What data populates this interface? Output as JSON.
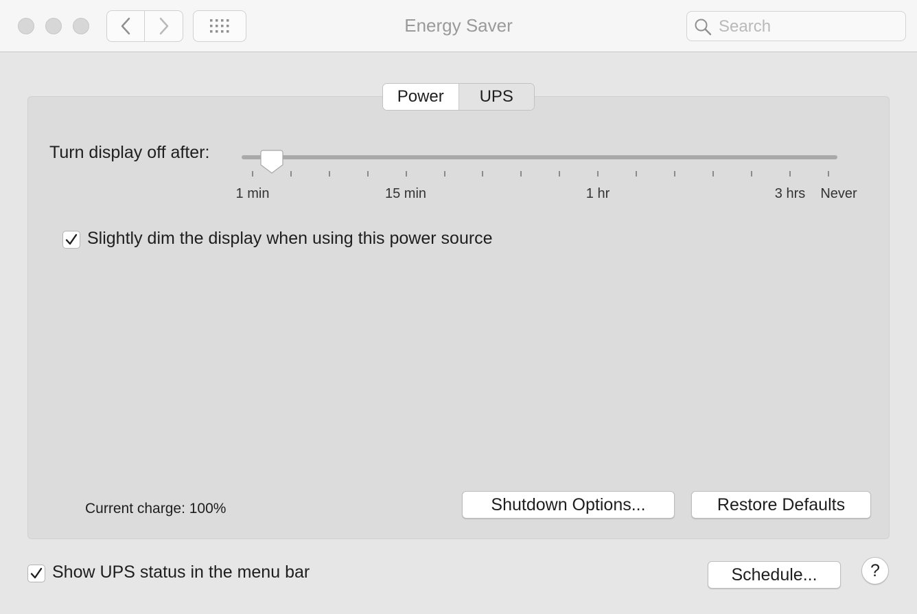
{
  "window": {
    "title": "Energy Saver"
  },
  "toolbar": {
    "search_placeholder": "Search"
  },
  "tabs": [
    {
      "label": "Power",
      "active": false
    },
    {
      "label": "UPS",
      "active": true
    }
  ],
  "display_sleep": {
    "label": "Turn display off after:",
    "value_label": "1 min",
    "tick_labels": [
      "1 min",
      "15 min",
      "1 hr",
      "3 hrs",
      "Never"
    ],
    "tick_count": 16
  },
  "dim_display": {
    "label": "Slightly dim the display when using this power source",
    "checked": true
  },
  "current_charge": "Current charge: 100%",
  "buttons": {
    "shutdown_options": "Shutdown Options...",
    "restore_defaults": "Restore Defaults",
    "schedule": "Schedule...",
    "help": "?"
  },
  "show_ups_status": {
    "label": "Show UPS status in the menu bar",
    "checked": true
  },
  "colors": {
    "window_bg": "#e6e6e6",
    "panel_bg": "#dcdcdc",
    "titlebar_bg": "#f6f6f6"
  }
}
